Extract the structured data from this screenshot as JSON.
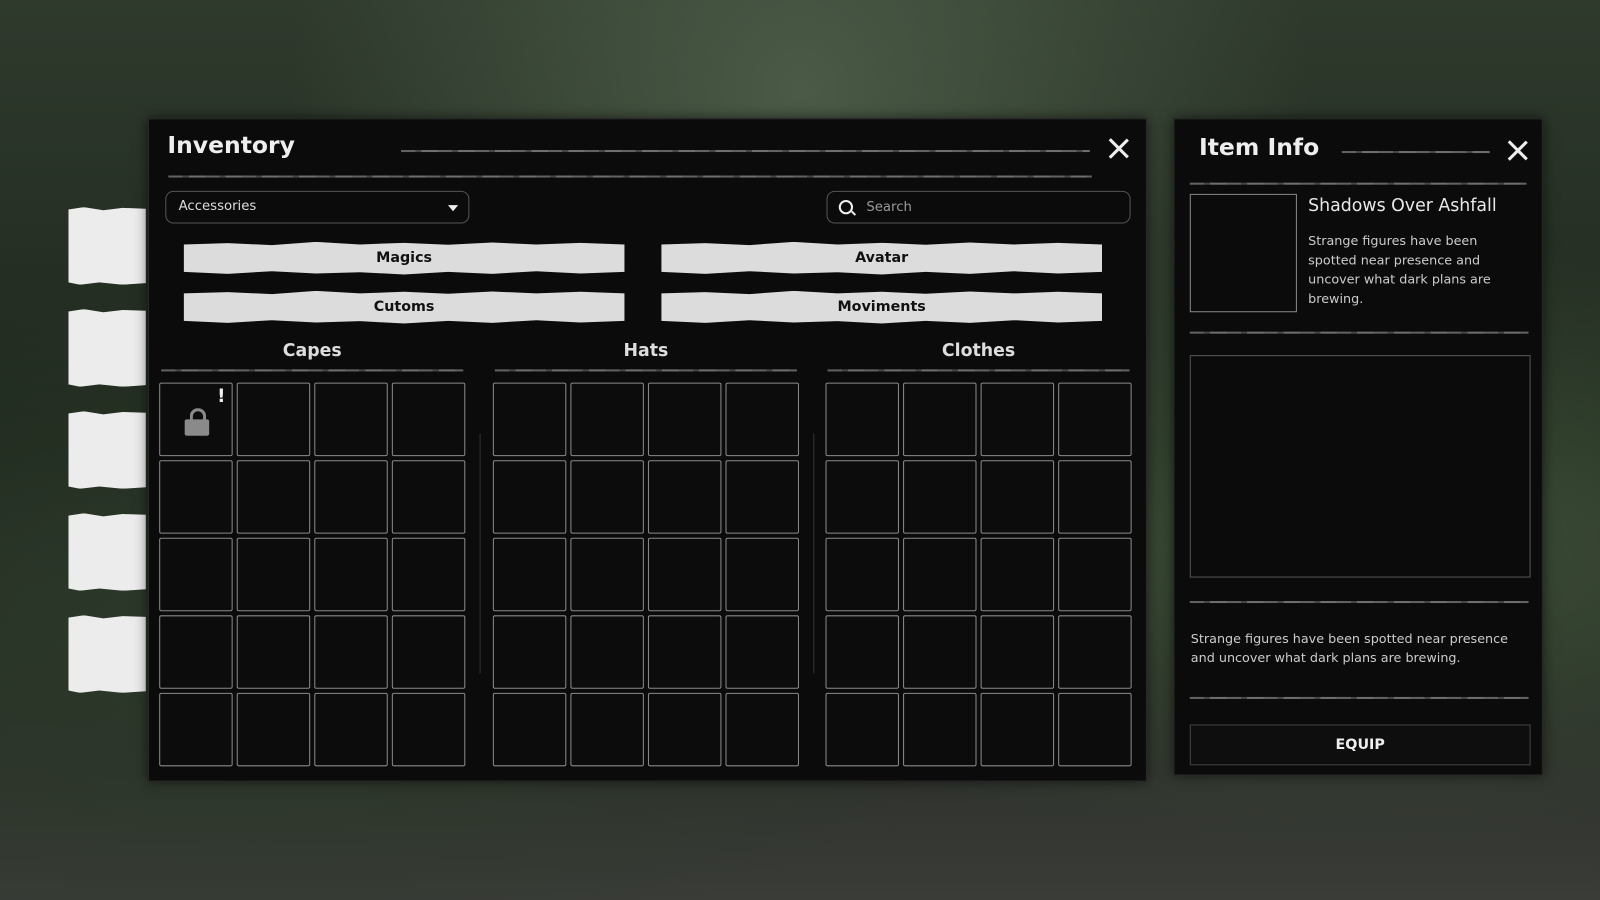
{
  "inventory": {
    "title": "Inventory",
    "category_select": {
      "value": "Accessories"
    },
    "search": {
      "placeholder": "Search",
      "value": ""
    },
    "categories": [
      "Magics",
      "Avatar",
      "Cutoms",
      "Moviments"
    ],
    "sections": [
      {
        "title": "Capes",
        "rows": 5,
        "cols": 4
      },
      {
        "title": "Hats",
        "rows": 5,
        "cols": 4
      },
      {
        "title": "Clothes",
        "rows": 5,
        "cols": 4
      }
    ],
    "first_slot": {
      "locked": true,
      "badge": "!"
    }
  },
  "item_info": {
    "title": "Item Info",
    "name": "Shadows Over Ashfall",
    "short_description": "Strange figures have been spotted near presence and uncover what dark plans are brewing.",
    "long_description": "Strange figures have been spotted near presence and uncover what dark plans are brewing.",
    "equip_label": "EQUIP"
  }
}
